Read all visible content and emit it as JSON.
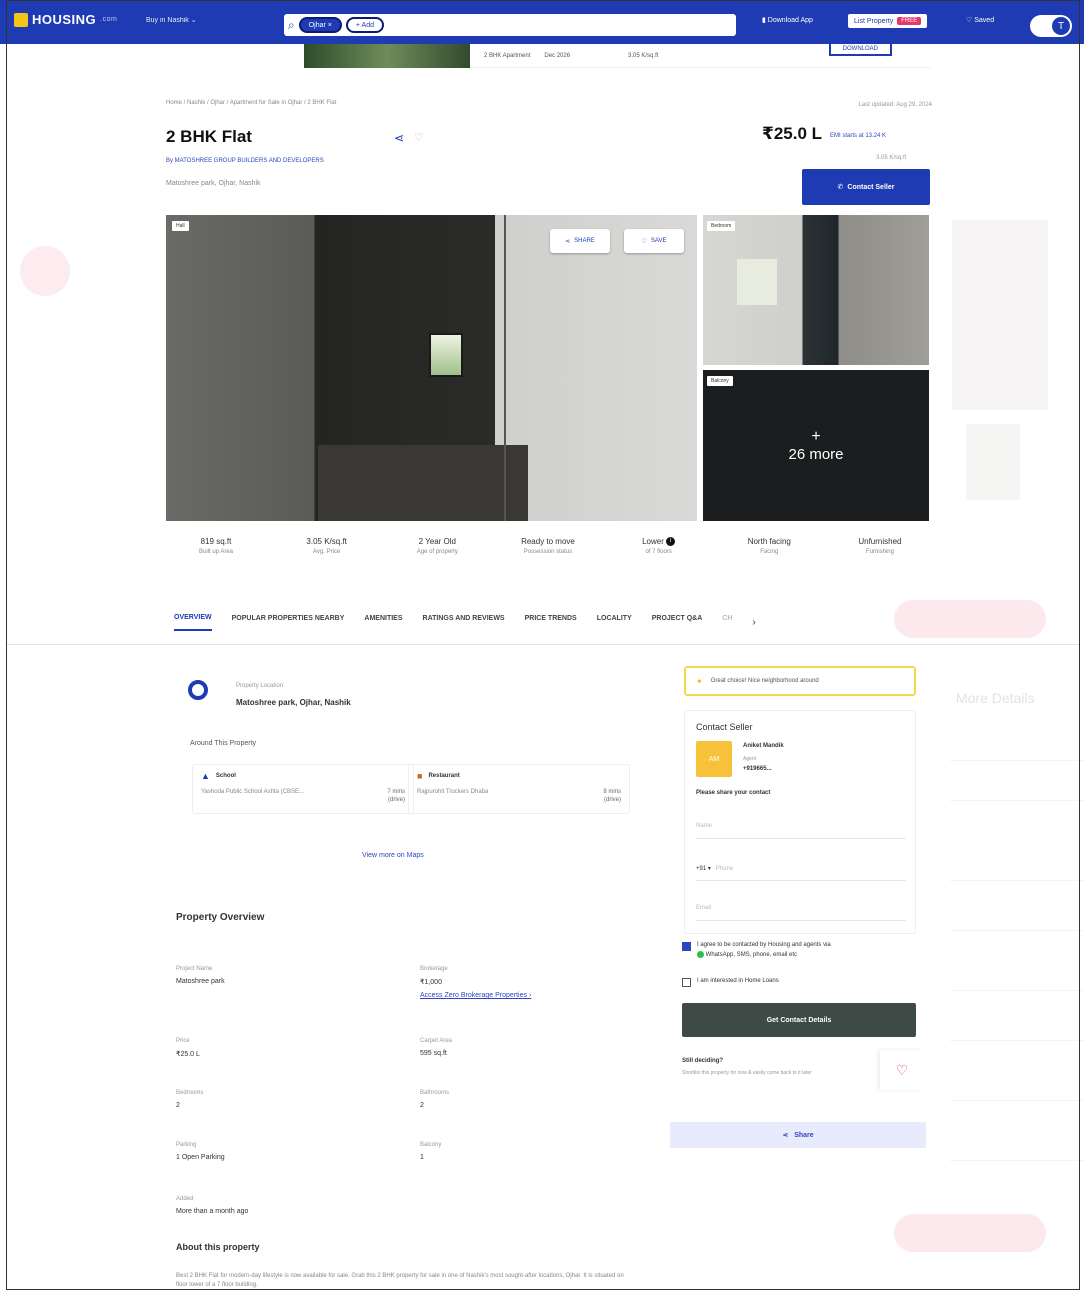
{
  "nav": {
    "logo": "HOUSING",
    "logo_sub": ".com",
    "city_select": "Buy in Nashik",
    "search_chip": "Ojhar",
    "search_add": "+ Add",
    "download_app": "Download App",
    "list_property": "List Property",
    "free_badge": "FREE",
    "saved": "Saved",
    "profile_initial": "T"
  },
  "sticky": {
    "config": "2 BHK Apartment",
    "possession": "Dec 2026",
    "price_sqft": "3.05 K/sq.ft",
    "download": "DOWNLOAD"
  },
  "header": {
    "breadcrumb": "Home / Nashik / Ojhar / Apartment for Sale in Ojhar / 2 BHK Flat",
    "last_updated": "Last updated: Aug 29, 2024",
    "title": "2 BHK Flat",
    "developer": "By MATOSHREE GROUP BUILDERS AND DEVELOPERS",
    "address": "Matoshree park, Ojhar, Nashik",
    "price": "₹25.0 L",
    "emi": "EMI starts at 13.24 K",
    "per_sqft": "3.05 K/sq.ft",
    "contact_button": "Contact Seller"
  },
  "gallery": {
    "main_tag": "Hall",
    "share_label": "SHARE",
    "save_label": "SAVE",
    "top_right_tag": "Bedroom",
    "bottom_right_tag": "Balcony",
    "more_plus": "+",
    "more_text": "26 more"
  },
  "facts": [
    {
      "value": "819 sq.ft",
      "label": "Built up Area"
    },
    {
      "value": "3.05 K/sq.ft",
      "label": "Avg. Price"
    },
    {
      "value": "2 Year Old",
      "label": "Age of property"
    },
    {
      "value": "Ready to move",
      "label": "Possession status"
    },
    {
      "value": "Lower",
      "label": "of 7 floors"
    },
    {
      "value": "North facing",
      "label": "Facing"
    },
    {
      "value": "Unfurnished",
      "label": "Furnishing"
    }
  ],
  "tabs": [
    "OVERVIEW",
    "POPULAR PROPERTIES NEARBY",
    "AMENITIES",
    "RATINGS AND REVIEWS",
    "PRICE TRENDS",
    "LOCALITY",
    "PROJECT Q&A",
    "CH"
  ],
  "location": {
    "label": "Property Location",
    "value": "Matoshree park, Ojhar, Nashik",
    "around_title": "Around This Property",
    "nearby": [
      {
        "category": "School",
        "name": "Yashoda Public School Ashta (CBSE...",
        "dist_value": "7 mins",
        "dist_mode": "(drive)"
      },
      {
        "category": "Restaurant",
        "name": "Rajpurohit Truckers Dhaba",
        "dist_value": "8 mins",
        "dist_mode": "(drive)"
      }
    ],
    "view_maps": "View more on Maps"
  },
  "overview": {
    "title": "Property Overview",
    "project_name_label": "Project Name",
    "project_name": "Matoshree park",
    "brokerage_label": "Brokerage",
    "brokerage": "₹1,000",
    "zero_brokerage_link": "Access Zero Brokerage Properties",
    "price_label": "Price",
    "price": "₹25.0 L",
    "carpet_label": "Carpet Area",
    "carpet": "595 sq.ft",
    "bedrooms_label": "Bedrooms",
    "bedrooms": "2",
    "bathrooms_label": "Bathrooms",
    "bathrooms": "2",
    "parking_label": "Parking",
    "parking": "1 Open Parking",
    "balcony_label": "Balcony",
    "balcony": "1",
    "added_label": "Added",
    "added": "More than a month ago",
    "about_title": "About this property",
    "about_text": "Best 2 BHK Flat for modern-day lifestyle is now available for sale. Grab this 2 BHK property for sale in one of Nashik's most sought-after locations, Ojhar. It is situated on floor lower of a 7 floor building."
  },
  "contact": {
    "notice": "Great choice! Nice neighborhood around",
    "title": "Contact Seller",
    "avatar": "AM",
    "agent_name": "Aniket Mandik",
    "agent_role": "Agent",
    "agent_phone": "+919665...",
    "share_contact": "Please share your contact",
    "name_placeholder": "Name",
    "country_code": "+91",
    "phone_placeholder": "Phone",
    "email_placeholder": "Email",
    "agree_text": "I agree to be contacted by Housing and agents via",
    "agree_text2": "WhatsApp, SMS, phone, email etc",
    "home_loans": "I am interested in Home Loans",
    "get_contact": "Get Contact Details",
    "still_title": "Still deciding?",
    "still_text": "Shortlist this property for now & easily come back to it later",
    "share": "Share"
  },
  "background": {
    "more_details": "More Details"
  },
  "colors": {
    "brand": "#1f3bb3",
    "accent_link": "#2d46c0",
    "badge_pink": "#e4376b",
    "cta_dark": "#3e4a46",
    "notice_yellow": "#f1da49"
  }
}
